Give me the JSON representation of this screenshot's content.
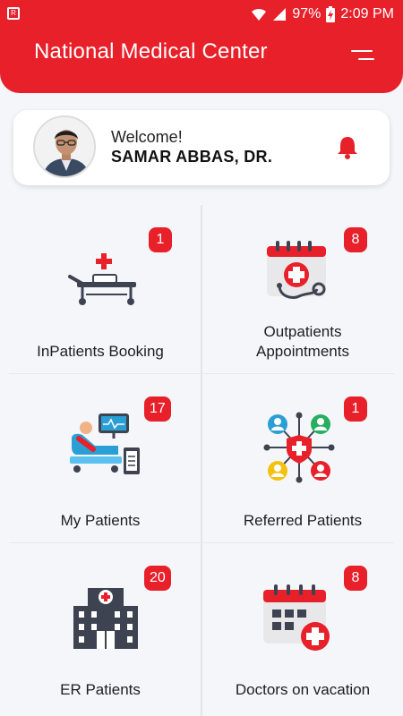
{
  "status_bar": {
    "battery": "97%",
    "time": "2:09 PM",
    "left_icon": "sim-icon",
    "icons": [
      "wifi-icon",
      "signal-icon",
      "battery-charging-icon"
    ]
  },
  "header": {
    "title": "National Medical Center",
    "menu_icon": "menu-icon",
    "color": "#e8202a"
  },
  "welcome": {
    "greeting": "Welcome!",
    "name": "SAMAR ABBAS, DR.",
    "notification_icon": "bell-icon"
  },
  "tiles": [
    {
      "label": "InPatients Booking",
      "badge": "1",
      "icon": "hospital-bed-icon"
    },
    {
      "label": "Outpatients\nAppointments",
      "badge": "8",
      "icon": "calendar-stethoscope-icon"
    },
    {
      "label": "My Patients",
      "badge": "17",
      "icon": "patient-monitor-icon"
    },
    {
      "label": "Referred Patients",
      "badge": "1",
      "icon": "referral-network-icon"
    },
    {
      "label": "ER Patients",
      "badge": "20",
      "icon": "hospital-building-icon"
    },
    {
      "label": "Doctors on vacation",
      "badge": "8",
      "icon": "calendar-medical-icon"
    }
  ]
}
